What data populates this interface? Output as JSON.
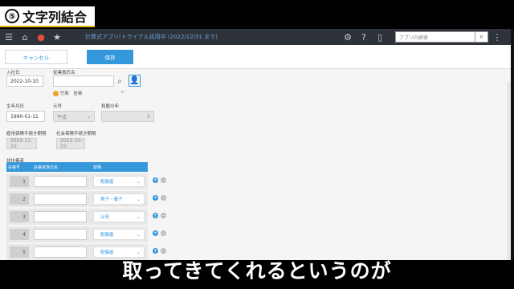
{
  "chapter": {
    "number": "⑤",
    "title": "文字列結合"
  },
  "topbar": {
    "app_title": "計算式アプリ(トライアル試用中 (2022/12/31 まで)",
    "search_placeholder": "アプリ内検索",
    "icons": [
      "menu-icon",
      "home-icon",
      "bell-icon",
      "star-icon",
      "gear-icon",
      "help-icon",
      "mobile-icon",
      "search-icon"
    ]
  },
  "actions": {
    "cancel": "キャンセル",
    "save": "保存"
  },
  "form": {
    "hire_date": {
      "label": "入社日",
      "value": "2022-10-10"
    },
    "employee": {
      "label": "従業員氏名",
      "value": "",
      "selected_user": "竹島　信雄"
    },
    "birth_date": {
      "label": "生年月日",
      "value": "1990-01-11"
    },
    "era": {
      "label": "元号",
      "value": "平成"
    },
    "year": {
      "label": "和暦の年",
      "value": "2"
    },
    "emp_insurance": {
      "label": "雇用保険手続き期限",
      "value": "2022-11-10"
    },
    "social_insurance": {
      "label": "社会保険手続き期限",
      "value": "2022-10-15"
    },
    "dependents": {
      "label": "扶扶養者"
    },
    "table": {
      "headers": [
        "扶養号",
        "扶養家族氏名",
        "続柄"
      ],
      "rows": [
        {
          "no": "1",
          "name": "",
          "relation": "配偶者"
        },
        {
          "no": "2",
          "name": "",
          "relation": "実子・養子"
        },
        {
          "no": "3",
          "name": "",
          "relation": "父母"
        },
        {
          "no": "4",
          "name": "",
          "relation": "配偶者"
        },
        {
          "no": "5",
          "name": "",
          "relation": "配偶者"
        }
      ]
    }
  },
  "subtitle": "取ってきてくれるというのが"
}
